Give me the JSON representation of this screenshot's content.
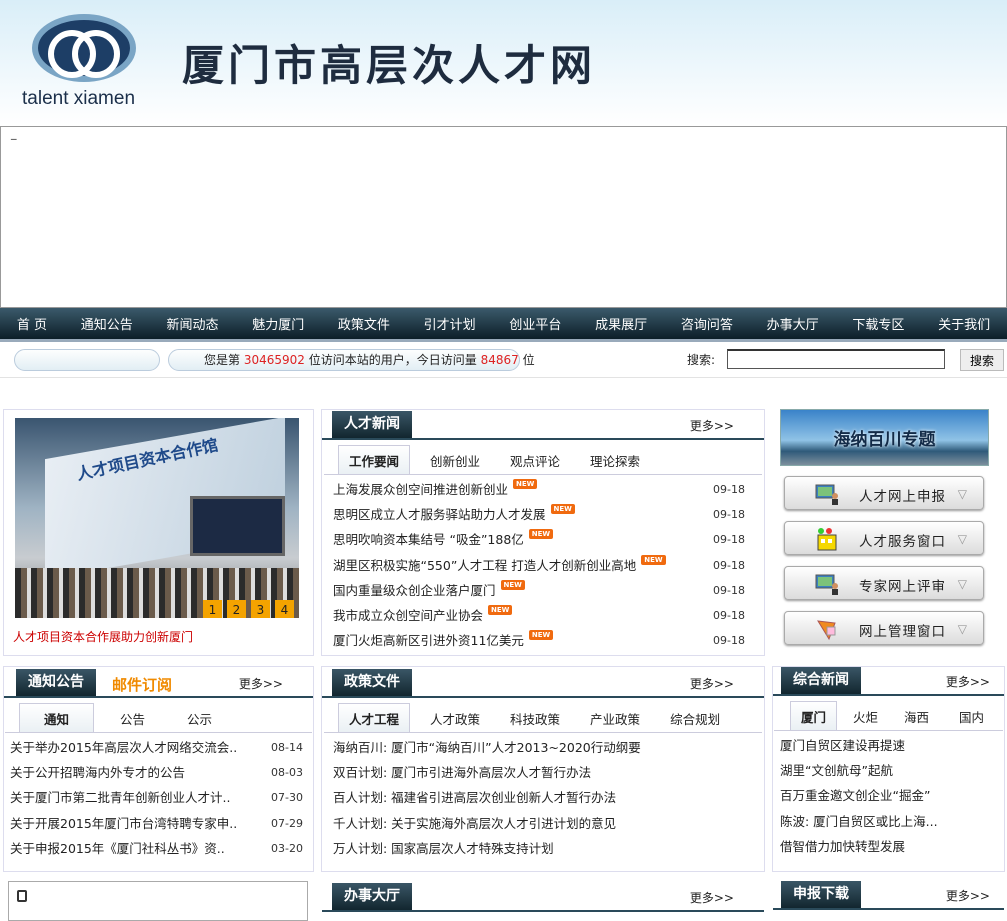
{
  "header": {
    "logo_text": "talent xiamen",
    "site_title": "厦门市高层次人才网"
  },
  "banner": {
    "cursor_text": "_"
  },
  "nav": [
    "首 页",
    "通知公告",
    "新闻动态",
    "魅力厦门",
    "政策文件",
    "引才计划",
    "创业平台",
    "成果展厅",
    "咨询问答",
    "办事大厅",
    "下载专区",
    "关于我们"
  ],
  "visits": {
    "prefix": "您是第",
    "total": "30465902",
    "middle": "位访问本站的用户，今日访问量",
    "today": "84867",
    "suffix": "位"
  },
  "search": {
    "label": "搜索:",
    "button": "搜索",
    "value": ""
  },
  "photo": {
    "sign": "人才项目资本合作馆",
    "slides": [
      "1",
      "2",
      "3",
      "4"
    ],
    "caption": "人才项目资本合作展助力创新厦门"
  },
  "talent_news": {
    "title": "人才新闻",
    "more": "更多>>",
    "tabs": [
      "工作要闻",
      "创新创业",
      "观点评论",
      "理论探索"
    ],
    "items": [
      {
        "text": "上海发展众创空间推进创新创业",
        "date": "09-18"
      },
      {
        "text": "思明区成立人才服务驿站助力人才发展",
        "date": "09-18"
      },
      {
        "text": "思明吹响资本集结号 “吸金”188亿",
        "date": "09-18"
      },
      {
        "text": "湖里区积极实施“550”人才工程 打造人才创新创业高地",
        "date": "09-18"
      },
      {
        "text": "国内重量级众创企业落户厦门",
        "date": "09-18"
      },
      {
        "text": "我市成立众创空间产业协会",
        "date": "09-18"
      },
      {
        "text": "厦门火炬高新区引进外资11亿美元",
        "date": "09-18"
      }
    ],
    "badge": "NEW"
  },
  "sidebar": {
    "banner": "海纳百川专题",
    "buttons": [
      "人才网上申报",
      "人才服务窗口",
      "专家网上评审",
      "网上管理窗口"
    ],
    "arrow": "▽"
  },
  "notices": {
    "title": "通知公告",
    "subscribe": "邮件订阅",
    "more": "更多>>",
    "tabs": [
      "通知",
      "公告",
      "公示"
    ],
    "items": [
      {
        "text": "关于举办2015年高层次人才网络交流会..",
        "date": "08-14"
      },
      {
        "text": "关于公开招聘海内外专才的公告",
        "date": "08-03"
      },
      {
        "text": "关于厦门市第二批青年创新创业人才计..",
        "date": "07-30"
      },
      {
        "text": "关于开展2015年厦门市台湾特聘专家申..",
        "date": "07-29"
      },
      {
        "text": "关于申报2015年《厦门社科丛书》资..",
        "date": "03-20"
      }
    ]
  },
  "policy": {
    "title": "政策文件",
    "more": "更多>>",
    "tabs": [
      "人才工程",
      "人才政策",
      "科技政策",
      "产业政策",
      "综合规划"
    ],
    "items": [
      "海纳百川: 厦门市“海纳百川”人才2013~2020行动纲要",
      "双百计划: 厦门市引进海外高层次人才暂行办法",
      "百人计划: 福建省引进高层次创业创新人才暂行办法",
      "千人计划: 关于实施海外高层次人才引进计划的意见",
      "万人计划: 国家高层次人才特殊支持计划"
    ]
  },
  "general_news": {
    "title": "综合新闻",
    "more": "更多>>",
    "tabs": [
      "厦门",
      "火炬",
      "海西",
      "国内"
    ],
    "items": [
      "厦门自贸区建设再提速",
      "湖里“文创航母”起航",
      "百万重金邀文创企业“掘金”",
      "陈波: 厦门自贸区或比上海...",
      "借智借力加快转型发展"
    ]
  },
  "bottom": {
    "office_title": "办事大厅",
    "office_more": "更多>>",
    "download_title": "申报下载",
    "download_more": "更多>>"
  }
}
